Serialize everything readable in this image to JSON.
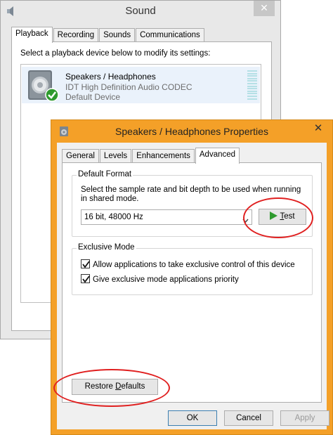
{
  "sound_window": {
    "title": "Sound",
    "close_glyph": "✕",
    "tabs": [
      {
        "label": "Playback"
      },
      {
        "label": "Recording"
      },
      {
        "label": "Sounds"
      },
      {
        "label": "Communications"
      }
    ],
    "instruction": "Select a playback device below to modify its settings:",
    "device": {
      "name": "Speakers / Headphones",
      "description": "IDT High Definition Audio CODEC",
      "status": "Default Device",
      "icon": "speaker-icon"
    }
  },
  "properties_window": {
    "title": "Speakers / Headphones Properties",
    "close_glyph": "✕",
    "tabs": [
      {
        "label": "General"
      },
      {
        "label": "Levels"
      },
      {
        "label": "Enhancements"
      },
      {
        "label": "Advanced"
      }
    ],
    "default_format": {
      "label": "Default Format",
      "description": "Select the sample rate and bit depth to be used when running in shared mode.",
      "selected_value": "16 bit, 48000 Hz",
      "test_label_prefix": "",
      "test_label_underlined": "T",
      "test_label_suffix": "est"
    },
    "exclusive_mode": {
      "label": "Exclusive Mode",
      "options": [
        {
          "label": "Allow applications to take exclusive control of this device",
          "checked": true
        },
        {
          "label": "Give exclusive mode applications priority",
          "checked": true
        }
      ]
    },
    "restore_defaults": {
      "prefix": "Restore ",
      "underlined": "D",
      "suffix": "efaults"
    },
    "buttons": {
      "ok": "OK",
      "cancel": "Cancel",
      "apply": "Apply"
    }
  },
  "colors": {
    "accent_titlebar": "#f4a028",
    "annotation": "#e02020",
    "play_icon": "#2e9a2e"
  }
}
